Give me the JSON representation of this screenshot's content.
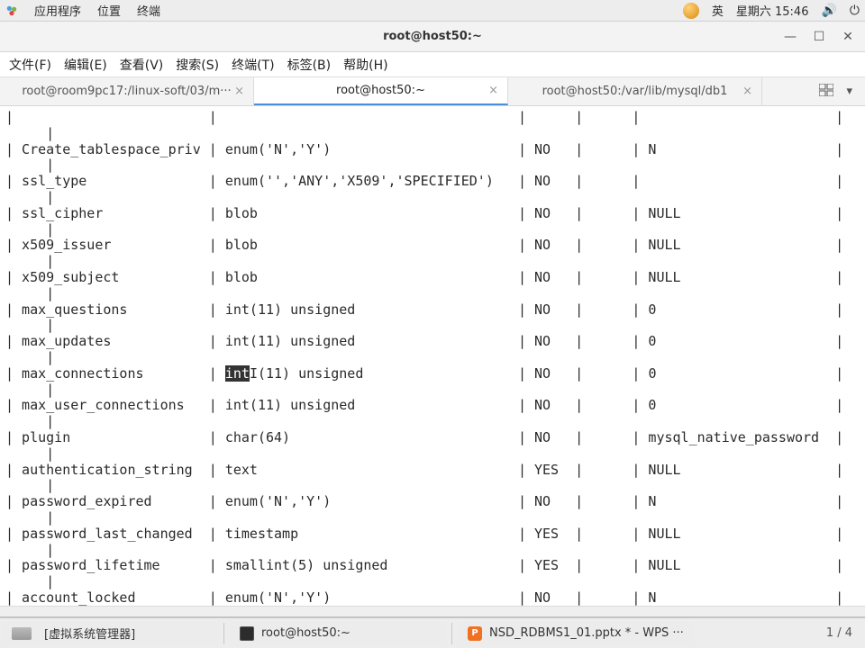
{
  "panel": {
    "menu_apps": "应用程序",
    "menu_places": "位置",
    "menu_term": "终端",
    "ime_text": "英",
    "date": "星期六 15:46"
  },
  "window": {
    "title": "root@host50:~"
  },
  "menubar": {
    "file": "文件(F)",
    "edit": "编辑(E)",
    "view": "查看(V)",
    "search": "搜索(S)",
    "terminal": "终端(T)",
    "tabs": "标签(B)",
    "help": "帮助(H)"
  },
  "tabs": {
    "t1": "root@room9pc17:/linux-soft/03/m···",
    "t2": "root@host50:~",
    "t3": "root@host50:/var/lib/mysql/db1"
  },
  "rows": [
    {
      "f": "",
      "t": "",
      "n": "",
      "d": ""
    },
    {
      "f": "Create_tablespace_priv",
      "t": "enum('N','Y')",
      "n": "NO",
      "d": "N"
    },
    {
      "f": "ssl_type",
      "t": "enum('','ANY','X509','SPECIFIED')",
      "n": "NO",
      "d": ""
    },
    {
      "f": "ssl_cipher",
      "t": "blob",
      "n": "NO",
      "d": "NULL"
    },
    {
      "f": "x509_issuer",
      "t": "blob",
      "n": "NO",
      "d": "NULL"
    },
    {
      "f": "x509_subject",
      "t": "blob",
      "n": "NO",
      "d": "NULL"
    },
    {
      "f": "max_questions",
      "t": "int(11) unsigned",
      "n": "NO",
      "d": "0"
    },
    {
      "f": "max_updates",
      "t": "int(11) unsigned",
      "n": "NO",
      "d": "0"
    },
    {
      "f": "max_connections",
      "t": "int(11) unsigned",
      "n": "NO",
      "d": "0",
      "hl": true
    },
    {
      "f": "max_user_connections",
      "t": "int(11) unsigned",
      "n": "NO",
      "d": "0"
    },
    {
      "f": "plugin",
      "t": "char(64)",
      "n": "NO",
      "d": "mysql_native_password"
    },
    {
      "f": "authentication_string",
      "t": "text",
      "n": "YES",
      "d": "NULL"
    },
    {
      "f": "password_expired",
      "t": "enum('N','Y')",
      "n": "NO",
      "d": "N"
    },
    {
      "f": "password_last_changed",
      "t": "timestamp",
      "n": "YES",
      "d": "NULL"
    },
    {
      "f": "password_lifetime",
      "t": "smallint(5) unsigned",
      "n": "YES",
      "d": "NULL"
    },
    {
      "f": "account_locked",
      "t": "enum('N','Y')",
      "n": "NO",
      "d": "N"
    }
  ],
  "cols": {
    "f": 22,
    "t": 35,
    "n": 4,
    "k": 4,
    "d": 22
  },
  "taskbar": {
    "vm": "[虚拟系统管理器]",
    "term": "root@host50:~",
    "wps": "NSD_RDBMS1_01.pptx * - WPS ···",
    "pager": "1 / 4"
  }
}
